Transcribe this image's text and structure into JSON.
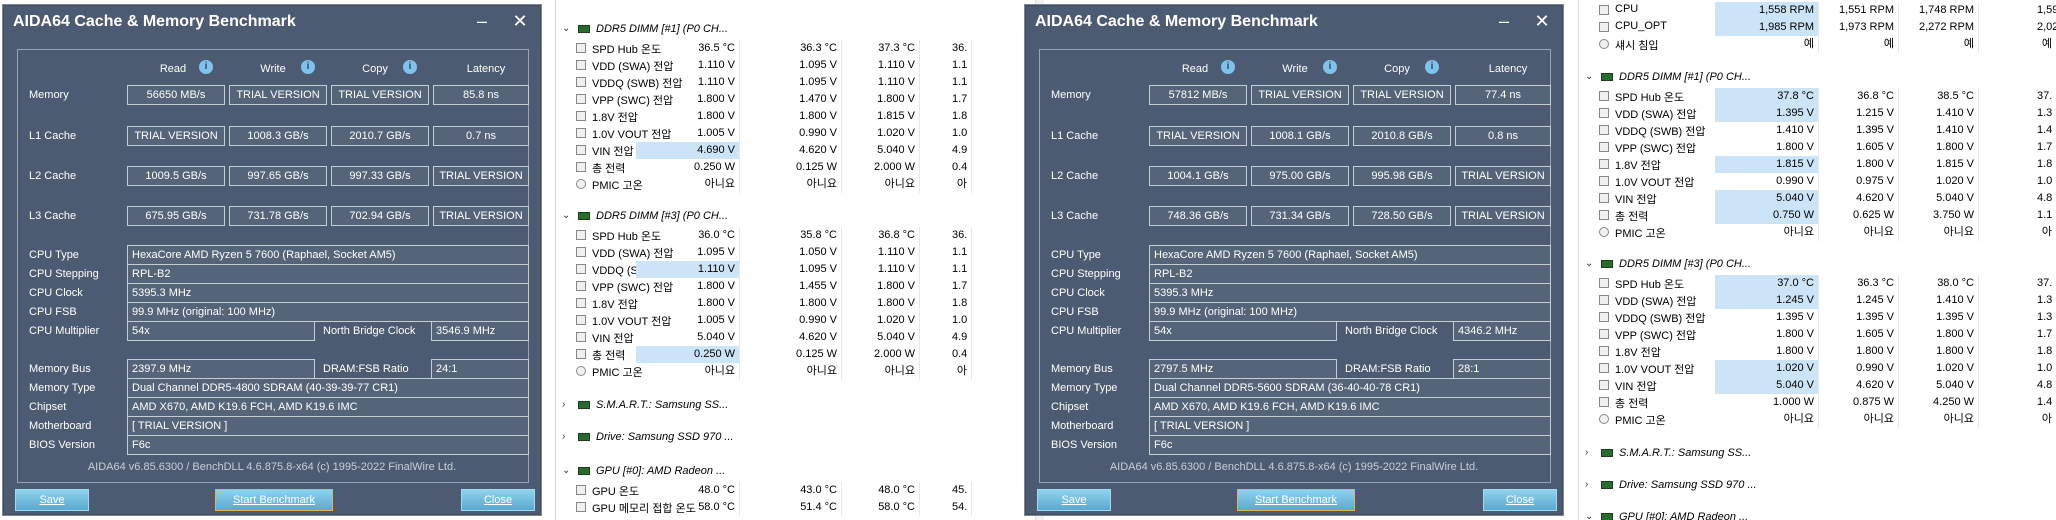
{
  "win1": {
    "title": "AIDA64 Cache & Memory Benchmark",
    "headers": [
      "Read",
      "Write",
      "Copy",
      "Latency"
    ],
    "bench": [
      {
        "label": "Memory",
        "values": [
          "56650 MB/s",
          "TRIAL VERSION",
          "TRIAL VERSION",
          "85.8 ns"
        ]
      },
      {
        "label": "L1 Cache",
        "values": [
          "TRIAL VERSION",
          "1008.3 GB/s",
          "2010.7 GB/s",
          "0.7 ns"
        ]
      },
      {
        "label": "L2 Cache",
        "values": [
          "1009.5 GB/s",
          "997.65 GB/s",
          "997.33 GB/s",
          "TRIAL VERSION"
        ]
      },
      {
        "label": "L3 Cache",
        "values": [
          "675.95 GB/s",
          "731.78 GB/s",
          "702.94 GB/s",
          "TRIAL VERSION"
        ]
      }
    ],
    "cpu_type_label": "CPU Type",
    "cpu_type": "HexaCore AMD Ryzen 5 7600  (Raphael, Socket AM5)",
    "cpu_step_label": "CPU Stepping",
    "cpu_step": "RPL-B2",
    "cpu_clock_label": "CPU Clock",
    "cpu_clock": "5395.3 MHz",
    "cpu_fsb_label": "CPU FSB",
    "cpu_fsb": "99.9 MHz  (original: 100 MHz)",
    "cpu_mult_label": "CPU Multiplier",
    "cpu_mult": "54x",
    "nb_label": "North Bridge Clock",
    "nb": "3546.9 MHz",
    "mem_bus_label": "Memory Bus",
    "mem_bus": "2397.9 MHz",
    "ratio_label": "DRAM:FSB Ratio",
    "ratio": "24:1",
    "mem_type_label": "Memory Type",
    "mem_type": "Dual Channel DDR5-4800 SDRAM  (40-39-39-77 CR1)",
    "chipset_label": "Chipset",
    "chipset": "AMD X670, AMD K19.6 FCH, AMD K19.6 IMC",
    "mobo_label": "Motherboard",
    "mobo": "[ TRIAL VERSION ]",
    "bios_label": "BIOS Version",
    "bios": "F6c",
    "footer": "AIDA64 v6.85.6300 / BenchDLL 4.6.875.8-x64  (c) 1995-2022 FinalWire Ltd.",
    "save": "Save",
    "start": "Start Benchmark",
    "close": "Close"
  },
  "win2": {
    "title": "AIDA64 Cache & Memory Benchmark",
    "headers": [
      "Read",
      "Write",
      "Copy",
      "Latency"
    ],
    "bench": [
      {
        "label": "Memory",
        "values": [
          "57812 MB/s",
          "TRIAL VERSION",
          "TRIAL VERSION",
          "77.4 ns"
        ]
      },
      {
        "label": "L1 Cache",
        "values": [
          "TRIAL VERSION",
          "1008.1 GB/s",
          "2010.8 GB/s",
          "0.8 ns"
        ]
      },
      {
        "label": "L2 Cache",
        "values": [
          "1004.1 GB/s",
          "975.00 GB/s",
          "995.98 GB/s",
          "TRIAL VERSION"
        ]
      },
      {
        "label": "L3 Cache",
        "values": [
          "748.36 GB/s",
          "731.34 GB/s",
          "728.50 GB/s",
          "TRIAL VERSION"
        ]
      }
    ],
    "cpu_type_label": "CPU Type",
    "cpu_type": "HexaCore AMD Ryzen 5 7600  (Raphael, Socket AM5)",
    "cpu_step_label": "CPU Stepping",
    "cpu_step": "RPL-B2",
    "cpu_clock_label": "CPU Clock",
    "cpu_clock": "5395.3 MHz",
    "cpu_fsb_label": "CPU FSB",
    "cpu_fsb": "99.9 MHz  (original: 100 MHz)",
    "cpu_mult_label": "CPU Multiplier",
    "cpu_mult": "54x",
    "nb_label": "North Bridge Clock",
    "nb": "4346.2 MHz",
    "mem_bus_label": "Memory Bus",
    "mem_bus": "2797.5 MHz",
    "ratio_label": "DRAM:FSB Ratio",
    "ratio": "28:1",
    "mem_type_label": "Memory Type",
    "mem_type": "Dual Channel DDR5-5600 SDRAM  (36-40-40-78 CR1)",
    "chipset_label": "Chipset",
    "chipset": "AMD X670, AMD K19.6 FCH, AMD K19.6 IMC",
    "mobo_label": "Motherboard",
    "mobo": "[ TRIAL VERSION ]",
    "bios_label": "BIOS Version",
    "bios": "F6c",
    "footer": "AIDA64 v6.85.6300 / BenchDLL 4.6.875.8-x64  (c) 1995-2022 FinalWire Ltd.",
    "save": "Save",
    "start": "Start Benchmark",
    "close": "Close"
  },
  "sensors1": {
    "dimm1": {
      "title": "DDR5 DIMM [#1] (P0 CH...",
      "rows": [
        {
          "name": "SPD Hub 온도",
          "v": [
            "36.5 °C",
            "36.3 °C",
            "37.3 °C",
            "36."
          ]
        },
        {
          "name": "VDD (SWA) 전압",
          "v": [
            "1.110 V",
            "1.095 V",
            "1.110 V",
            "1.1"
          ]
        },
        {
          "name": "VDDQ (SWB) 전압",
          "v": [
            "1.110 V",
            "1.095 V",
            "1.110 V",
            "1.1"
          ]
        },
        {
          "name": "VPP (SWC) 전압",
          "v": [
            "1.800 V",
            "1.470 V",
            "1.800 V",
            "1.7"
          ]
        },
        {
          "name": "1.8V 전압",
          "v": [
            "1.800 V",
            "1.800 V",
            "1.815 V",
            "1.8"
          ]
        },
        {
          "name": "1.0V VOUT 전압",
          "v": [
            "1.005 V",
            "0.990 V",
            "1.020 V",
            "1.0"
          ]
        },
        {
          "name": "VIN 전압",
          "v": [
            "4.690 V",
            "4.620 V",
            "5.040 V",
            "4.9"
          ]
        },
        {
          "name": "총 전력",
          "v": [
            "0.250 W",
            "0.125 W",
            "2.000 W",
            "0.4"
          ]
        },
        {
          "name": "PMIC 고온",
          "v": [
            "아니요",
            "아니요",
            "아니요",
            "아"
          ]
        }
      ]
    },
    "dimm3": {
      "title": "DDR5 DIMM [#3] (P0 CH...",
      "rows": [
        {
          "name": "SPD Hub 온도",
          "v": [
            "36.0 °C",
            "35.8 °C",
            "36.8 °C",
            "36."
          ]
        },
        {
          "name": "VDD (SWA) 전압",
          "v": [
            "1.095 V",
            "1.050 V",
            "1.110 V",
            "1.1"
          ]
        },
        {
          "name": "VDDQ (SWB) 전압",
          "v": [
            "1.110 V",
            "1.095 V",
            "1.110 V",
            "1.1"
          ]
        },
        {
          "name": "VPP (SWC) 전압",
          "v": [
            "1.800 V",
            "1.455 V",
            "1.800 V",
            "1.7"
          ]
        },
        {
          "name": "1.8V 전압",
          "v": [
            "1.800 V",
            "1.800 V",
            "1.800 V",
            "1.8"
          ]
        },
        {
          "name": "1.0V VOUT 전압",
          "v": [
            "1.005 V",
            "0.990 V",
            "1.020 V",
            "1.0"
          ]
        },
        {
          "name": "VIN 전압",
          "v": [
            "5.040 V",
            "4.620 V",
            "5.040 V",
            "4.9"
          ]
        },
        {
          "name": "총 전력",
          "v": [
            "0.250 W",
            "0.125 W",
            "2.000 W",
            "0.4"
          ]
        },
        {
          "name": "PMIC 고온",
          "v": [
            "아니요",
            "아니요",
            "아니요",
            "아"
          ]
        }
      ]
    },
    "smart": "S.M.A.R.T.: Samsung SS...",
    "drive": "Drive: Samsung SSD 970 ...",
    "gpu": "GPU [#0]: AMD Radeon ...",
    "gpu_rows": [
      {
        "name": "GPU 온도",
        "v": [
          "48.0 °C",
          "43.0 °C",
          "48.0 °C",
          "45."
        ]
      },
      {
        "name": "GPU 메모리 접합 온도",
        "v": [
          "58.0 °C",
          "51.4 °C",
          "58.0 °C",
          "54."
        ]
      }
    ]
  },
  "sensors2": {
    "top": [
      {
        "name": "CPU",
        "v": [
          "1,558 RPM",
          "1,551 RPM",
          "1,748 RPM",
          "1,59"
        ]
      },
      {
        "name": "CPU_OPT",
        "v": [
          "1,985 RPM",
          "1,973 RPM",
          "2,272 RPM",
          "2,028"
        ]
      },
      {
        "name": "섀시 침입",
        "v": [
          "예",
          "예",
          "예",
          "예"
        ]
      }
    ],
    "dimm1": {
      "title": "DDR5 DIMM [#1] (P0 CH...",
      "rows": [
        {
          "name": "SPD Hub 온도",
          "v": [
            "37.8 °C",
            "36.8 °C",
            "38.5 °C",
            "37."
          ]
        },
        {
          "name": "VDD (SWA) 전압",
          "v": [
            "1.395 V",
            "1.215 V",
            "1.410 V",
            "1.3"
          ]
        },
        {
          "name": "VDDQ (SWB) 전압",
          "v": [
            "1.410 V",
            "1.395 V",
            "1.410 V",
            "1.4"
          ]
        },
        {
          "name": "VPP (SWC) 전압",
          "v": [
            "1.800 V",
            "1.605 V",
            "1.800 V",
            "1.7"
          ]
        },
        {
          "name": "1.8V 전압",
          "v": [
            "1.815 V",
            "1.800 V",
            "1.815 V",
            "1.8"
          ]
        },
        {
          "name": "1.0V VOUT 전압",
          "v": [
            "0.990 V",
            "0.975 V",
            "1.020 V",
            "1.0"
          ]
        },
        {
          "name": "VIN 전압",
          "v": [
            "5.040 V",
            "4.620 V",
            "5.040 V",
            "4.8"
          ]
        },
        {
          "name": "총 전력",
          "v": [
            "0.750 W",
            "0.625 W",
            "3.750 W",
            "1.1"
          ]
        },
        {
          "name": "PMIC 고온",
          "v": [
            "아니요",
            "아니요",
            "아니요",
            "아"
          ]
        }
      ]
    },
    "dimm3": {
      "title": "DDR5 DIMM [#3] (P0 CH...",
      "rows": [
        {
          "name": "SPD Hub 온도",
          "v": [
            "37.0 °C",
            "36.3 °C",
            "38.0 °C",
            "37."
          ]
        },
        {
          "name": "VDD (SWA) 전압",
          "v": [
            "1.245 V",
            "1.245 V",
            "1.410 V",
            "1.3"
          ]
        },
        {
          "name": "VDDQ (SWB) 전압",
          "v": [
            "1.395 V",
            "1.395 V",
            "1.395 V",
            "1.3"
          ]
        },
        {
          "name": "VPP (SWC) 전압",
          "v": [
            "1.800 V",
            "1.605 V",
            "1.800 V",
            "1.7"
          ]
        },
        {
          "name": "1.8V 전압",
          "v": [
            "1.800 V",
            "1.800 V",
            "1.800 V",
            "1.8"
          ]
        },
        {
          "name": "1.0V VOUT 전압",
          "v": [
            "1.020 V",
            "0.990 V",
            "1.020 V",
            "1.0"
          ]
        },
        {
          "name": "VIN 전압",
          "v": [
            "5.040 V",
            "4.620 V",
            "5.040 V",
            "4.8"
          ]
        },
        {
          "name": "총 전력",
          "v": [
            "1.000 W",
            "0.875 W",
            "4.250 W",
            "1.4"
          ]
        },
        {
          "name": "PMIC 고온",
          "v": [
            "아니요",
            "아니요",
            "아니요",
            "아"
          ]
        }
      ]
    },
    "smart": "S.M.A.R.T.: Samsung SS...",
    "drive": "Drive: Samsung SSD 970 ...",
    "gpu": "GPU [#0]: AMD Radeon ..."
  },
  "colors": {
    "window_bg": "#4d5b72",
    "highlight": "#cce4f7",
    "button": "#6fbfe0"
  }
}
